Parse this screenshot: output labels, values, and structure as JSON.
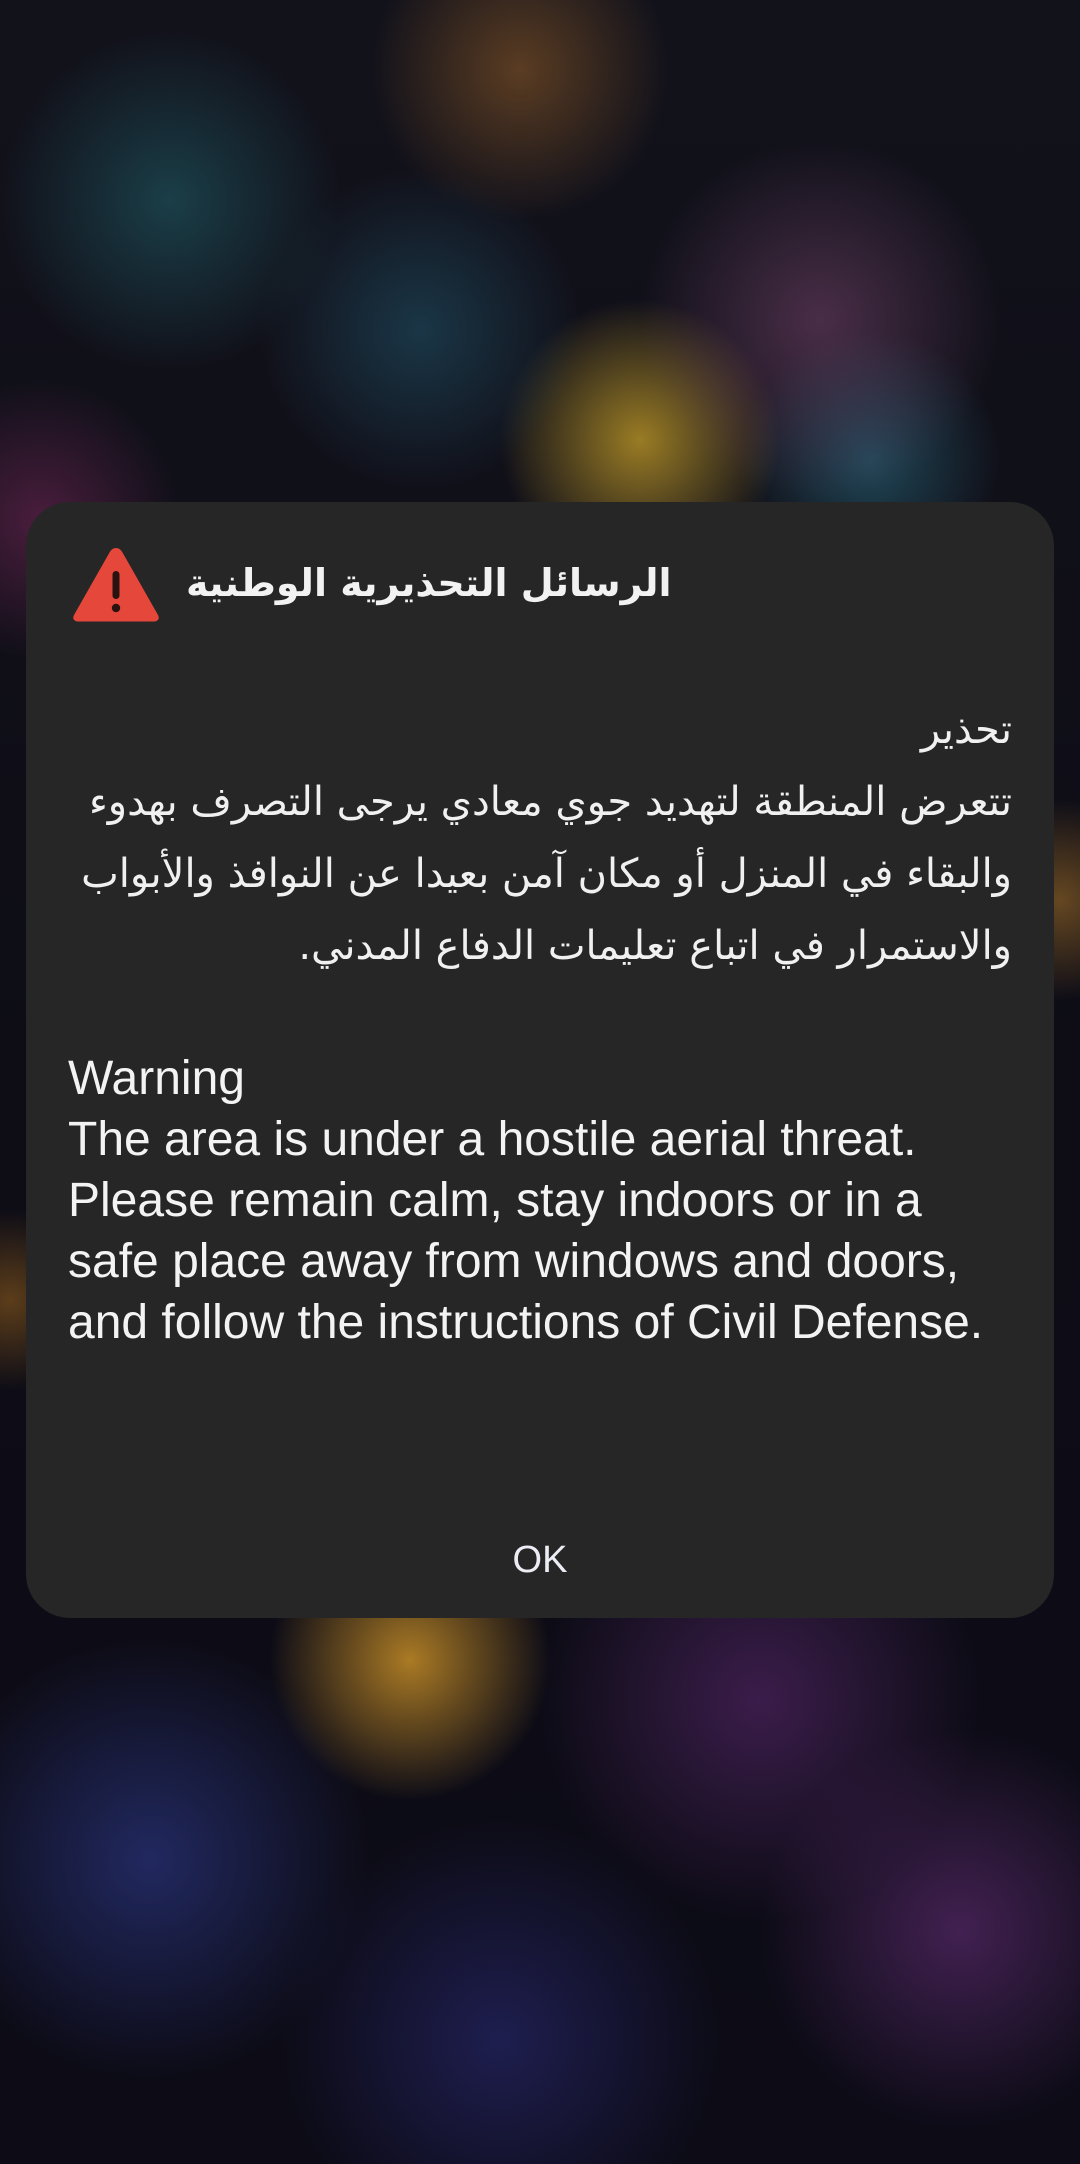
{
  "dialog": {
    "icon": "warning-triangle-icon",
    "icon_color": "#e5473a",
    "title": "الرسائل التحذيرية الوطنية",
    "arabic_heading": "تحذير",
    "arabic_message": "تتعرض المنطقة لتهديد جوي معادي يرجى التصرف بهدوء والبقاء في المنزل أو مكان آمن بعيدا عن النوافذ والأبواب والاستمرار في اتباع تعليمات الدفاع المدني.",
    "english_heading": "Warning",
    "english_message": "The area is under a hostile aerial threat. Please remain calm, stay indoors or in a safe place away from windows and doors, and follow the instructions of Civil Defense.",
    "ok_label": "OK",
    "background_color": "#262626"
  }
}
